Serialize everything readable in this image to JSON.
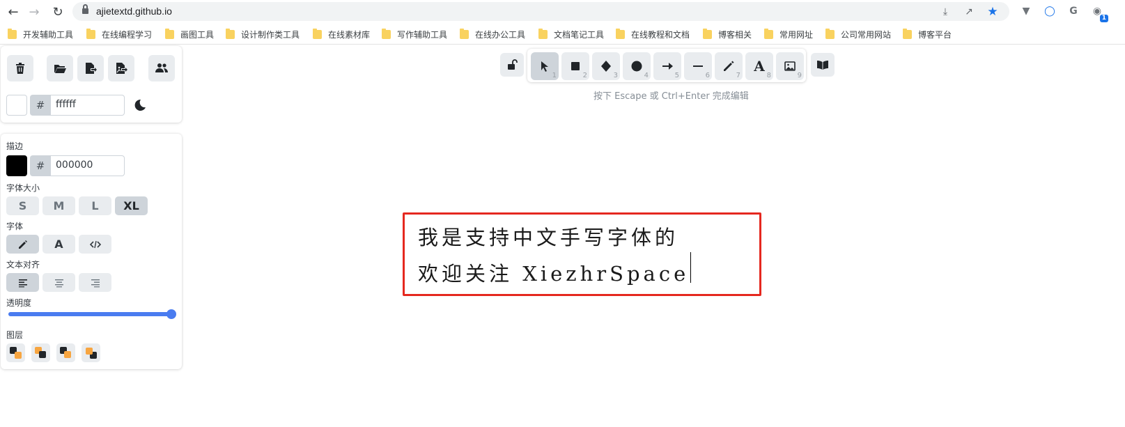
{
  "browser": {
    "url": "ajietextd.github.io",
    "extension_badge": "1"
  },
  "bookmarks": [
    "开发辅助工具",
    "在线编程学习",
    "画图工具",
    "设计制作类工具",
    "在线素材库",
    "写作辅助工具",
    "在线办公工具",
    "文档笔记工具",
    "在线教程和文档",
    "博客相关",
    "常用网址",
    "公司常用网站",
    "博客平台"
  ],
  "canvas_panel": {
    "hash": "#",
    "background_hex": "ffffff"
  },
  "properties": {
    "stroke_label": "描边",
    "stroke_hash": "#",
    "stroke_hex": "000000",
    "font_size_label": "字体大小",
    "font_sizes": [
      "S",
      "M",
      "L",
      "XL"
    ],
    "font_family_label": "字体",
    "font_family_text_glyph": "A",
    "text_align_label": "文本对齐",
    "opacity_label": "透明度",
    "opacity_value": 1.0,
    "layers_label": "图层"
  },
  "toolbar": {
    "numbers": [
      "1",
      "2",
      "3",
      "4",
      "5",
      "6",
      "7",
      "8",
      "9"
    ],
    "text_glyph": "A",
    "hint": "按下 Escape 或 Ctrl+Enter 完成编辑"
  },
  "canvas_text": {
    "line1": "我是支持中文手写字体的",
    "line2": "欢迎关注 XiezhrSpace"
  },
  "colors": {
    "accent": "#4a7cf0",
    "highlight_border": "#e5281f",
    "button_bg": "#e9ecef",
    "button_active_bg": "#ced4da"
  }
}
